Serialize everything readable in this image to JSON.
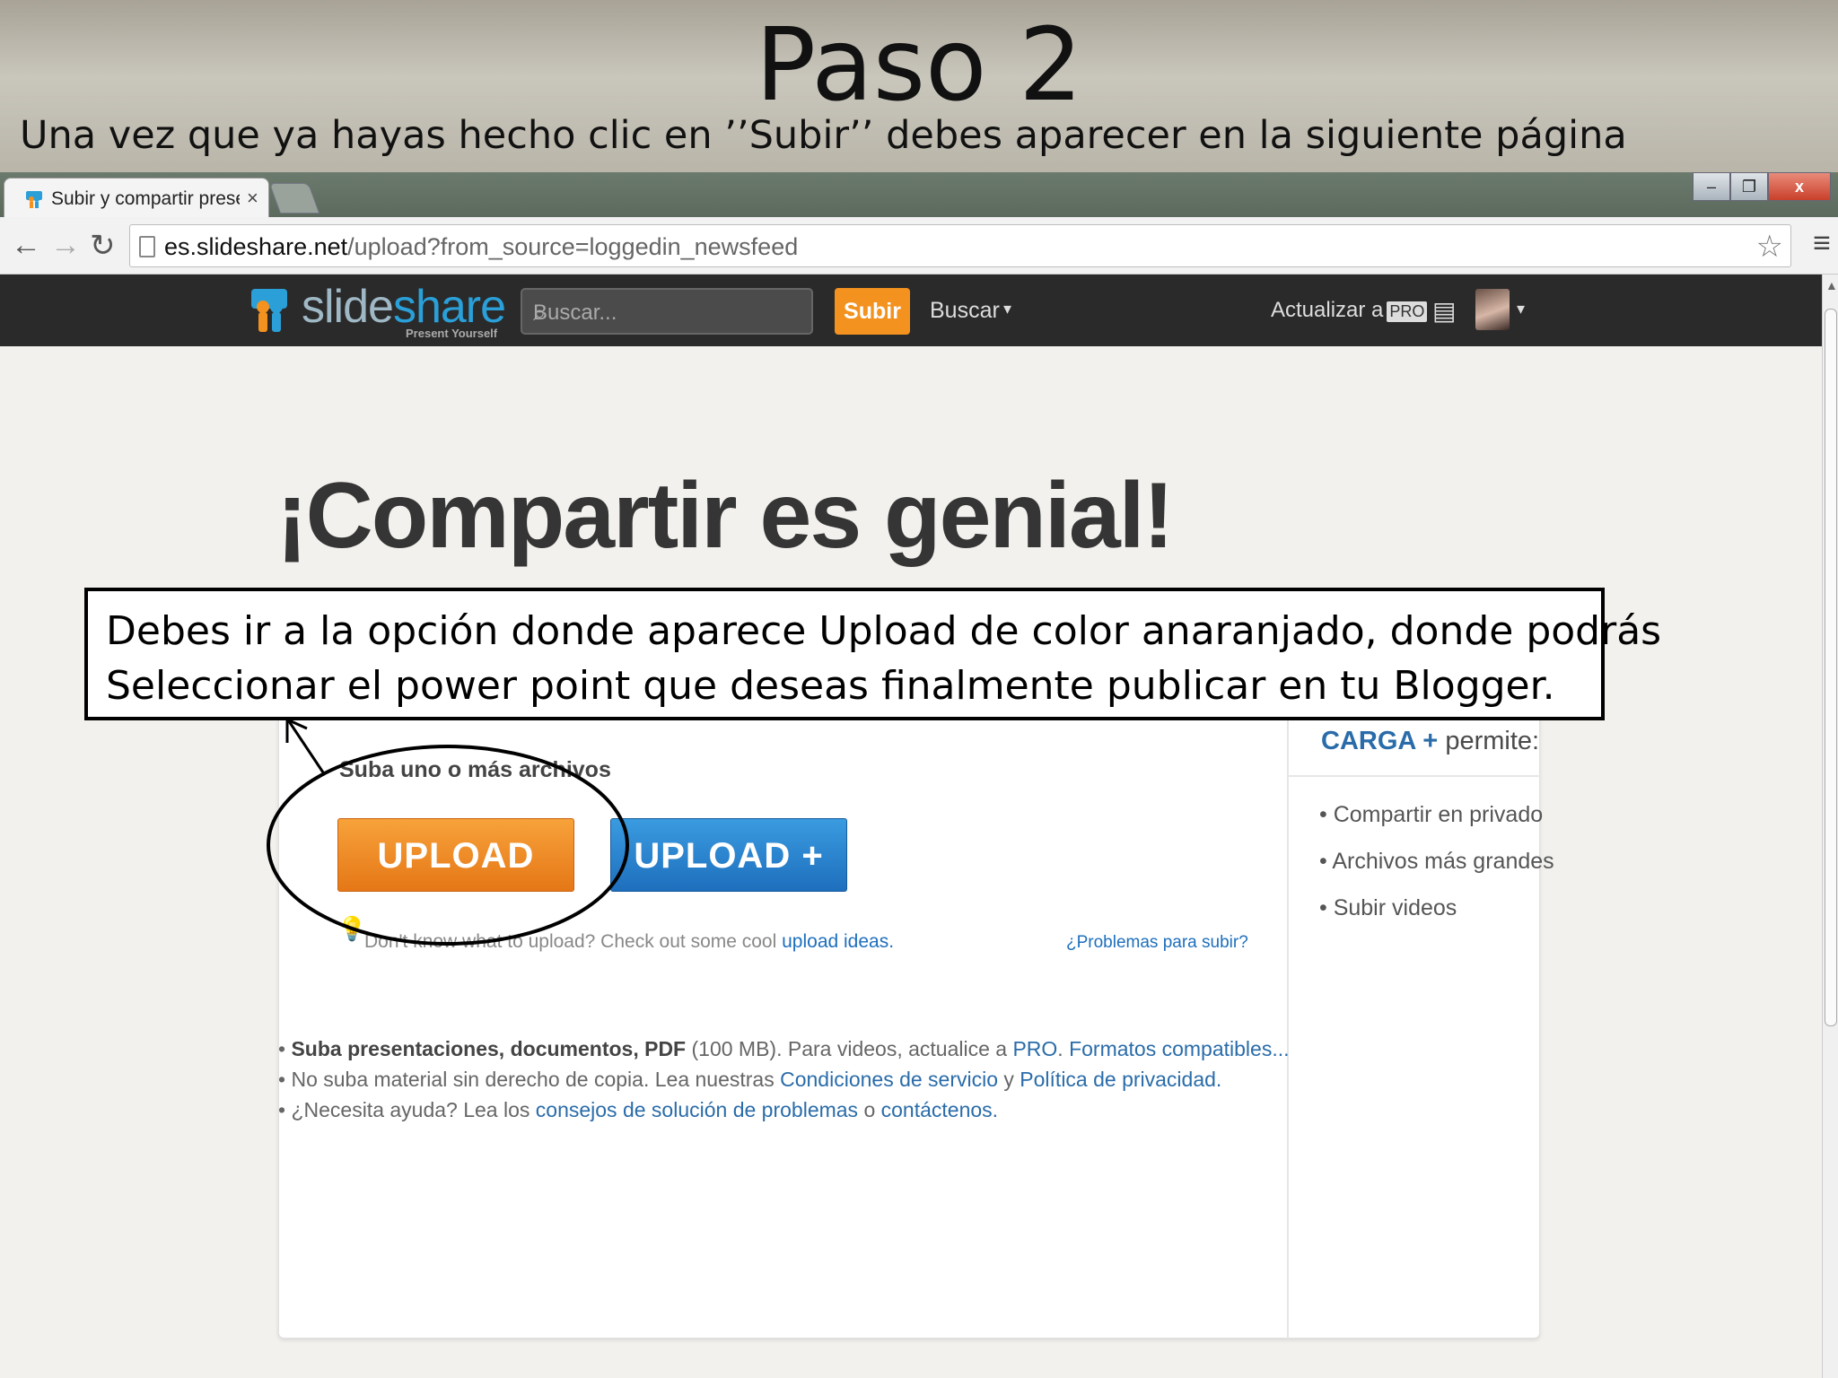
{
  "slide": {
    "title": "Paso 2",
    "subtitle": "Una vez que ya hayas hecho clic en ’’Subir’’ debes aparecer en la siguiente página",
    "callout_line1": "Debes ir a la opción donde aparece Upload de color anaranjado, donde podrás",
    "callout_line2": "Seleccionar el power point que deseas finalmente publicar en tu Blogger."
  },
  "browser": {
    "tab_title": "Subir y compartir present",
    "tab_close": "×",
    "url_host": "es.slideshare.net",
    "url_path": "/upload?from_source=loggedin_newsfeed",
    "window_controls": [
      "–",
      "❐",
      "x"
    ],
    "icons": [
      "back-icon",
      "forward-icon",
      "reload-icon",
      "bookmark-star-icon",
      "menu-icon"
    ]
  },
  "slideshare": {
    "logo_slide": "slide",
    "logo_share": "share",
    "tagline": "Present Yourself",
    "search_placeholder": "Buscar...",
    "upload_button": "Subir",
    "browse_menu": "Buscar",
    "upgrade_text": "Actualizar a",
    "pro_badge": "PRO"
  },
  "page": {
    "headline": "¡Compartir es genial!",
    "upload_label": "Suba uno o más archivos",
    "upload_button": "UPLOAD",
    "upload_plus_button": "UPLOAD +",
    "ideas_prefix": "Don't know what to upload? Check out some cool",
    "ideas_link": "upload ideas.",
    "problems_link": "¿Problemas para subir?",
    "carga_label": "CARGA +",
    "carga_suffix": "permite:",
    "carga_features": [
      "Compartir en privado",
      "Archivos más grandes",
      "Subir videos"
    ],
    "notes": {
      "n1_bold": "Suba presentaciones, documentos, PDF",
      "n1_rest": " (100 MB). Para videos, actualice a ",
      "n1_pro": "PRO",
      "n1_formats": "Formatos compatibles...",
      "n2_text": "No suba material sin derecho de copia. Lea nuestras ",
      "n2_terms": "Condiciones de servicio",
      "n2_and": " y ",
      "n2_privacy": "Política de privacidad.",
      "n3_text": "¿Necesita ayuda? Lea los ",
      "n3_tips": "consejos de solución de problemas",
      "n3_or": " o ",
      "n3_contact": "contáctenos."
    }
  },
  "colors": {
    "orange": "#f3921e",
    "blue": "#1e6fbd",
    "header_dark": "#2a2a2a"
  }
}
